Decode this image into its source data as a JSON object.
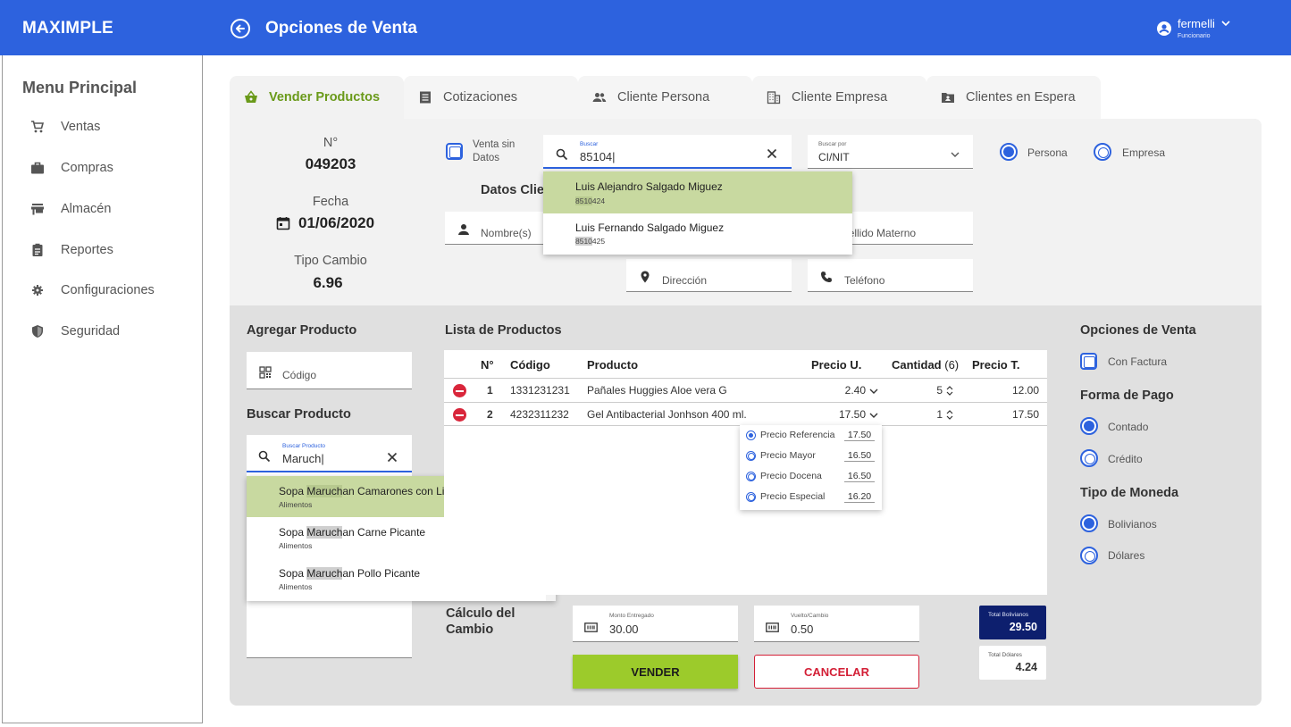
{
  "app": {
    "brand": "MAXIMPLE",
    "page_title": "Opciones de Venta"
  },
  "user": {
    "name": "fermelli",
    "role": "Funcionario"
  },
  "sidebar": {
    "title": "Menu Principal",
    "items": [
      {
        "label": "Ventas",
        "icon": "cart-icon"
      },
      {
        "label": "Compras",
        "icon": "briefcase-icon"
      },
      {
        "label": "Almacén",
        "icon": "store-icon"
      },
      {
        "label": "Reportes",
        "icon": "clipboard-icon"
      },
      {
        "label": "Configuraciones",
        "icon": "gear-icon"
      },
      {
        "label": "Seguridad",
        "icon": "shield-icon"
      }
    ]
  },
  "tabs": [
    {
      "label": "Vender Productos",
      "icon": "basket-icon",
      "active": true
    },
    {
      "label": "Cotizaciones",
      "icon": "list-icon"
    },
    {
      "label": "Cliente Persona",
      "icon": "people-icon"
    },
    {
      "label": "Cliente Empresa",
      "icon": "building-icon"
    },
    {
      "label": "Clientes en Espera",
      "icon": "contact-folder-icon"
    }
  ],
  "sale_info": {
    "number_label": "N°",
    "number": "049203",
    "date_label": "Fecha",
    "date": "01/06/2020",
    "exchange_label": "Tipo Cambio",
    "exchange": "6.96"
  },
  "client": {
    "no_data_label_1": "Venta sin",
    "no_data_label_2": "Datos",
    "search_label": "Buscar",
    "search_value": "85104|",
    "search_by_label": "Buscar por",
    "search_by_value": "CI/NIT",
    "persona": "Persona",
    "empresa": "Empresa",
    "section_title": "Datos Clie",
    "nombre_placeholder": "Nombre(s)",
    "apellido_materno_placeholder": "pellido Materno",
    "direccion_placeholder": "Dirección",
    "telefono_placeholder": "Teléfono",
    "results": [
      {
        "name": "Luis Alejandro Salgado Miguez",
        "id_match": "8510",
        "id_rest": "424"
      },
      {
        "name": "Luis Fernando Salgado Miguez",
        "id_match": "8510",
        "id_rest": "425"
      }
    ]
  },
  "add_product": {
    "title": "Agregar Producto",
    "code_placeholder": "Código",
    "search_title": "Buscar Producto",
    "search_label": "Buscar Producto",
    "search_value": "Maruch|",
    "results": [
      {
        "pre": "Sopa ",
        "match": "Maruch",
        "post": "an Camarones con Limón",
        "category": "Alimentos"
      },
      {
        "pre": "Sopa ",
        "match": "Maruch",
        "post": "an Carne Picante",
        "category": "Alimentos"
      },
      {
        "pre": "Sopa ",
        "match": "Maruch",
        "post": "an Pollo Picante",
        "category": "Alimentos"
      }
    ]
  },
  "product_list": {
    "title": "Lista de Productos",
    "headers": {
      "num": "N°",
      "code": "Código",
      "product": "Producto",
      "unit_price": "Precio U.",
      "qty": "Cantidad",
      "qty_count": "(6)",
      "total": "Precio T."
    },
    "rows": [
      {
        "num": "1",
        "code": "1331231231",
        "product": "Pañales Huggies Aloe vera G",
        "unit_price": "2.40",
        "qty": "5",
        "total": "12.00"
      },
      {
        "num": "2",
        "code": "4232311232",
        "product": "Gel Antibacterial Jonhson 400 ml.",
        "unit_price": "17.50",
        "qty": "1",
        "total": "17.50"
      }
    ],
    "price_options": [
      {
        "label": "Precio Referencia",
        "value": "17.50",
        "selected": true
      },
      {
        "label": "Precio Mayor",
        "value": "16.50"
      },
      {
        "label": "Precio Docena",
        "value": "16.50"
      },
      {
        "label": "Precio Especial",
        "value": "16.20"
      }
    ]
  },
  "change_calc": {
    "title_1": "Cálculo del",
    "title_2": "Cambio",
    "given_label": "Monto Entregado",
    "given_value": "30.00",
    "change_label": "Vuelto/Cambio",
    "change_value": "0.50"
  },
  "totals": {
    "bs_label": "Total Bolivianos",
    "bs_value": "29.50",
    "usd_label": "Total Dólares",
    "usd_value": "4.24"
  },
  "actions": {
    "sell": "VENDER",
    "cancel": "CANCELAR"
  },
  "sale_options": {
    "title": "Opciones de Venta",
    "invoice": "Con Factura",
    "payment_title": "Forma de Pago",
    "cash": "Contado",
    "credit": "Crédito",
    "currency_title": "Tipo de Moneda",
    "bolivianos": "Bolivianos",
    "dolares": "Dólares"
  },
  "colors": {
    "primary": "#2d62de",
    "accent_green": "#9ccb2b",
    "danger": "#d31f36",
    "navy": "#0d1f6e",
    "highlight": "#c8d9a0"
  }
}
